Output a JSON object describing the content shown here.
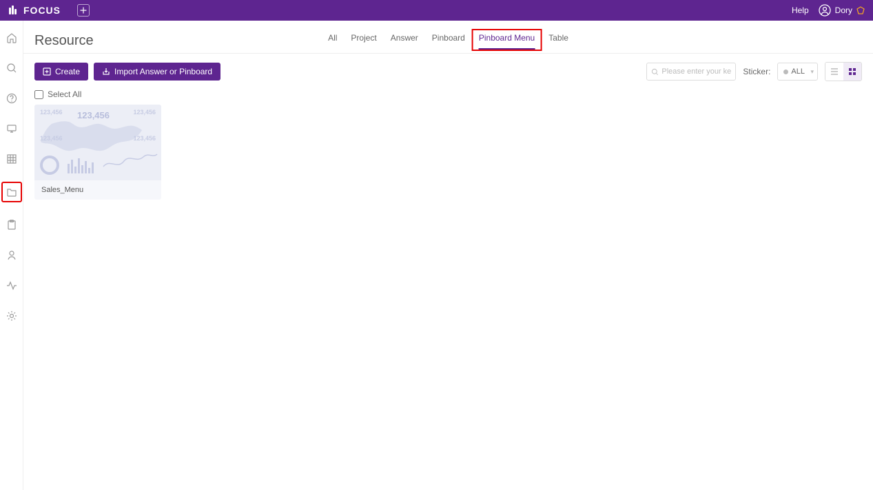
{
  "brand": "FOCUS",
  "header": {
    "help": "Help",
    "user_name": "Dory"
  },
  "page": {
    "title": "Resource"
  },
  "tabs": [
    {
      "id": "all",
      "label": "All",
      "active": false
    },
    {
      "id": "project",
      "label": "Project",
      "active": false
    },
    {
      "id": "answer",
      "label": "Answer",
      "active": false
    },
    {
      "id": "pinboard",
      "label": "Pinboard",
      "active": false
    },
    {
      "id": "pinboard-menu",
      "label": "Pinboard Menu",
      "active": true
    },
    {
      "id": "table",
      "label": "Table",
      "active": false
    }
  ],
  "toolbar": {
    "create_label": "Create",
    "import_label": "Import Answer or Pinboard",
    "search_placeholder": "Please enter your keywo",
    "sticker_label": "Sticker:",
    "sticker_value": "ALL",
    "select_all_label": "Select All"
  },
  "cards": [
    {
      "title": "Sales_Menu"
    }
  ],
  "sidebar_icons": [
    "home",
    "search",
    "help-circle",
    "monitor",
    "grid",
    "folder",
    "clipboard",
    "user",
    "activity",
    "settings"
  ]
}
